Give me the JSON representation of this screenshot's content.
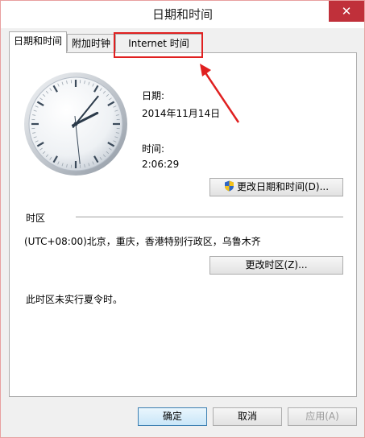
{
  "window": {
    "title": "日期和时间",
    "close_glyph": "✕"
  },
  "tabs": [
    {
      "label": "日期和时间",
      "active": true
    },
    {
      "label": "附加时钟",
      "active": false
    },
    {
      "label": "Internet 时间",
      "active": false
    }
  ],
  "datetime": {
    "date_label": "日期:",
    "date_value": "2014年11月14日",
    "time_label": "时间:",
    "time_value": "2:06:29",
    "change_button": "更改日期和时间(D)..."
  },
  "timezone": {
    "section_label": "时区",
    "value": "(UTC+08:00)北京，重庆，香港特别行政区，乌鲁木齐",
    "change_button": "更改时区(Z)...",
    "dst_note": "此时区未实行夏令时。"
  },
  "footer": {
    "ok": "确定",
    "cancel": "取消",
    "apply": "应用(A)"
  },
  "colors": {
    "annotation": "#e02020",
    "close_button": "#c0303a"
  },
  "clock_time": {
    "hour": 2,
    "minute": 6,
    "second": 29
  }
}
